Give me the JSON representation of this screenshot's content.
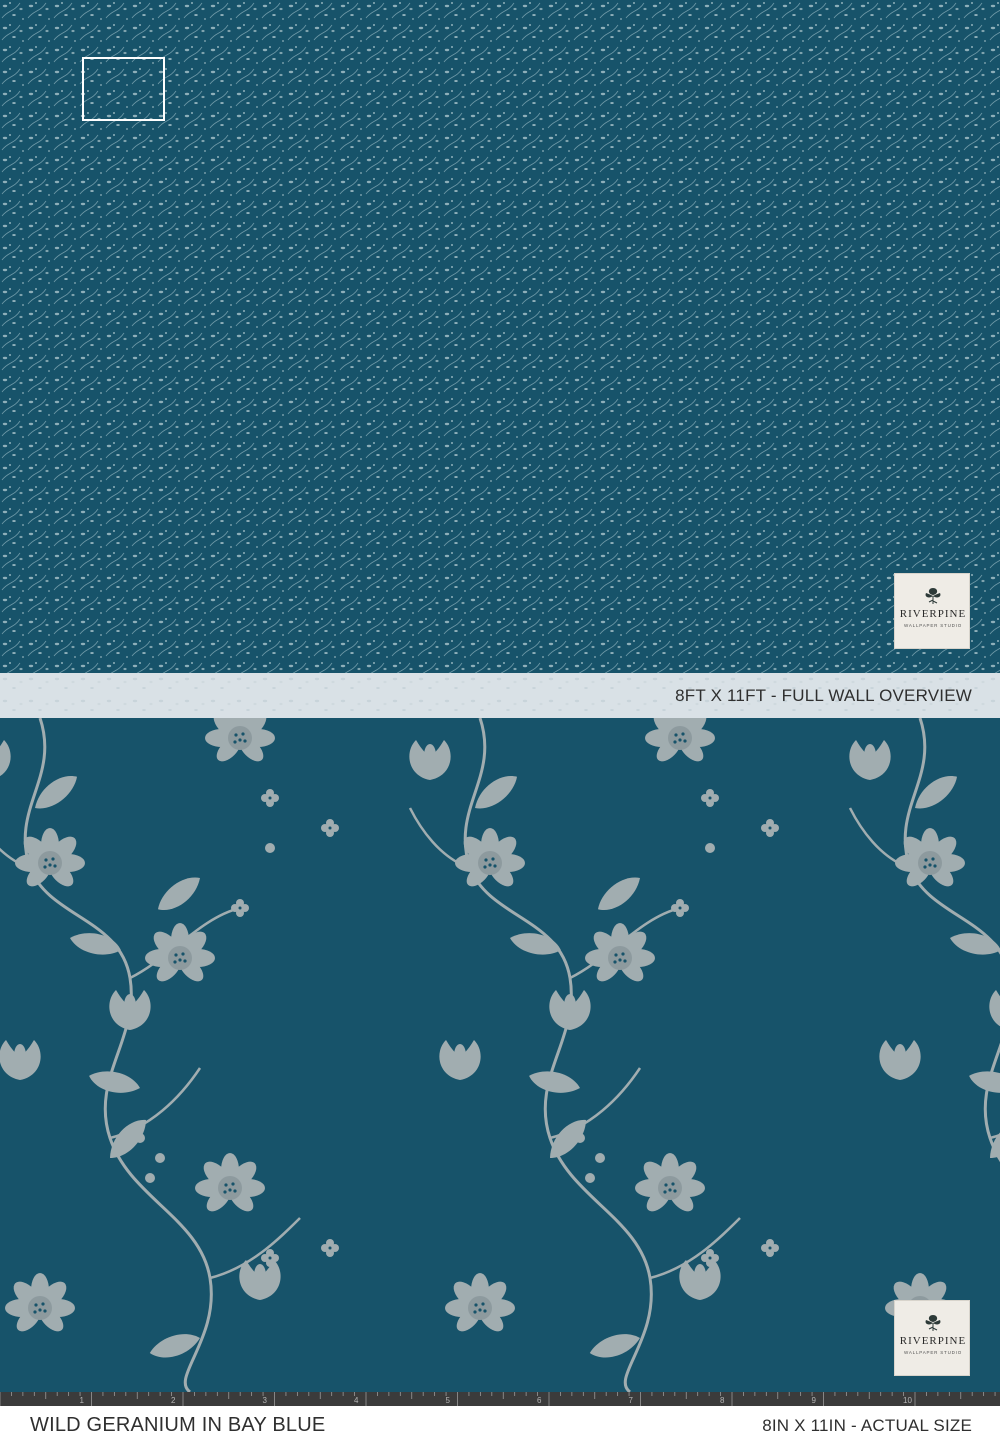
{
  "colors": {
    "background": "#17536a",
    "motif": "#a1adb0",
    "band": "#d9e1e6",
    "text": "#2f2f2f"
  },
  "overview": {
    "label": "8FT X 11FT - FULL WALL OVERVIEW"
  },
  "footer": {
    "pattern_name": "WILD GERANIUM  IN BAY BLUE",
    "actual_size": "8IN X 11IN - ACTUAL SIZE"
  },
  "logo": {
    "name": "RIVERPINE",
    "subtitle": "WALLPAPER STUDIO"
  },
  "ruler": {
    "marks": [
      "1",
      "2",
      "3",
      "4",
      "5",
      "6",
      "7",
      "8",
      "9",
      "10"
    ]
  }
}
